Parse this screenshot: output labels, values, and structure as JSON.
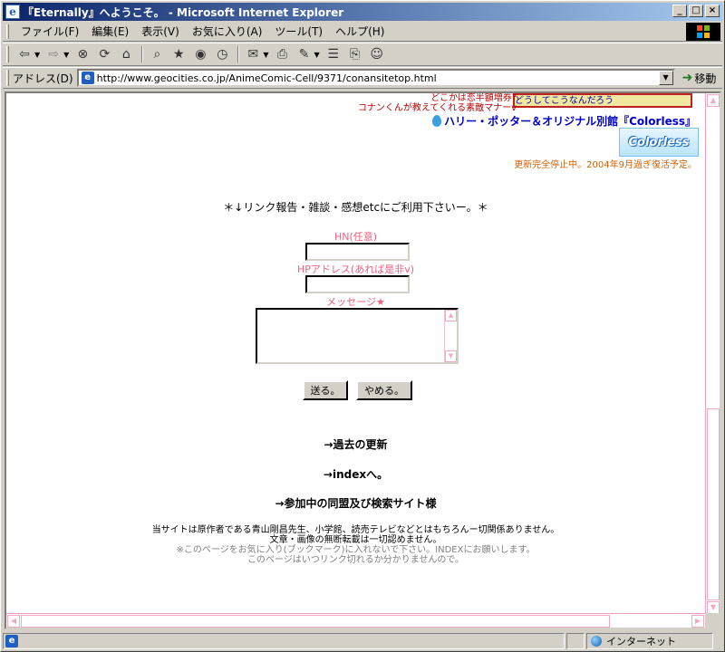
{
  "window": {
    "title": "『Eternally』へようこそ。 - Microsoft Internet Explorer",
    "minimize": "_",
    "maximize": "□",
    "close": "×"
  },
  "menu": [
    "ファイル(F)",
    "編集(E)",
    "表示(V)",
    "お気に入り(A)",
    "ツール(T)",
    "ヘルプ(H)"
  ],
  "address": {
    "label": "アドレス(D)",
    "url": "http://www.geocities.co.jp/AnimeComic-Cell/9371/conansitetop.html",
    "go_label": "移動"
  },
  "page": {
    "banner_text": "どうしてこうなんだろう",
    "small_line_1": "どこかは恋半額増券?",
    "small_line_2": "コナンくんが教えてくれる素敵マナーv",
    "harry_link": "ハリー・ポッター＆オリジナル別館『Colorless』",
    "colorless_banner": "Colorless",
    "update_stop": "更新完全停止中。2004年9月過ぎ復活予定。",
    "form_heading": "＊↓リンク報告・雑談・感想etcにご利用下さいー。＊",
    "label_hn": "HN(任意)",
    "label_hp": "HPアドレス(あれば是非v)",
    "label_message": "メッセージ★",
    "submit_label": "送る。",
    "reset_label": "やめる。",
    "nav_past": "→過去の更新",
    "nav_index": "→indexへ。",
    "nav_links": "→参加中の同盟及び検索サイト様",
    "footer_1": "当サイトは原作者である青山剛昌先生、小学館、読売テレビなどとはもちろんー切関係ありません。",
    "footer_2": "文章・画像の無断転載は一切認めません。",
    "footer_3": "※このページをお気に入り(ブックマーク)に入れないで下さい。INDEXにお願いします。",
    "footer_4": "このページはいつリンク切れるか分かりませんので。"
  },
  "status": {
    "zone": "インターネット"
  },
  "colors": {
    "label_pink": "#f06080",
    "link_blue": "#0000cc",
    "notice_orange": "#d06000",
    "footer_gray": "#808080"
  }
}
